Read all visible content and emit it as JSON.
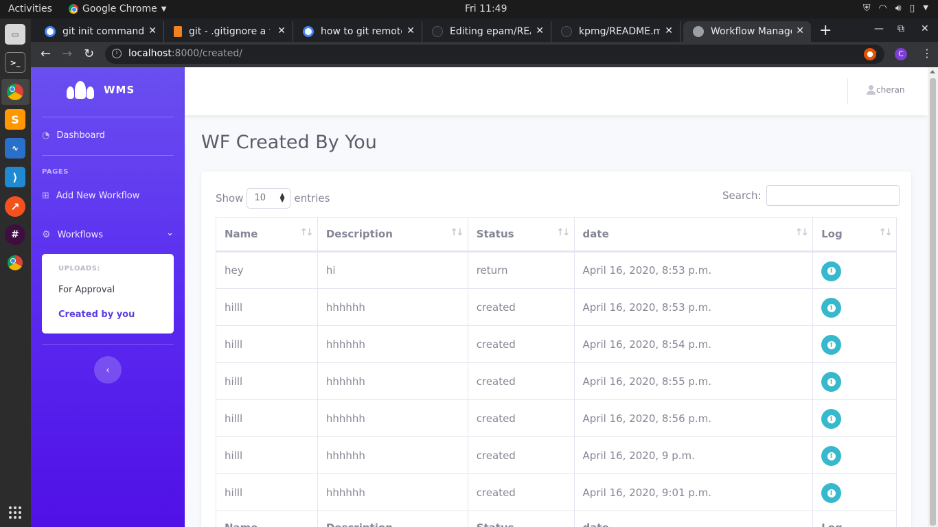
{
  "os": {
    "activities_label": "Activities",
    "app_name": "Google Chrome",
    "clock": "Fri 11:49"
  },
  "browser": {
    "tabs": [
      {
        "title": "git init command -",
        "favicon_color": "#4285f4"
      },
      {
        "title": "git - .gitignore a fo",
        "favicon_color": "#f48024"
      },
      {
        "title": "how to git remote",
        "favicon_color": "#4285f4"
      },
      {
        "title": "Editing epam/REA",
        "favicon_color": "#24292e"
      },
      {
        "title": "kpmg/README.m",
        "favicon_color": "#24292e"
      },
      {
        "title": "Workflow Manage",
        "favicon_color": "#9aa0a6"
      }
    ],
    "url_host": "localhost",
    "url_path": ":8000/created/",
    "profile_initial": "C"
  },
  "sidebar": {
    "brand": "WMS",
    "dashboard_label": "Dashboard",
    "pages_heading": "PAGES",
    "add_workflow_label": "Add New Workflow",
    "workflows_label": "Workflows",
    "uploads_heading": "UPLOADS:",
    "for_approval_label": "For Approval",
    "created_by_you_label": "Created by you"
  },
  "topnav": {
    "username": "cheran"
  },
  "main": {
    "title": "WF Created By You",
    "show_label": "Show",
    "entries_value": "10",
    "entries_label": "entries",
    "search_label": "Search:"
  },
  "table": {
    "columns": [
      "Name",
      "Description",
      "Status",
      "date",
      "Log"
    ],
    "rows": [
      {
        "name": "hey",
        "description": "hi",
        "status": "return",
        "date": "April 16, 2020, 8:53 p.m."
      },
      {
        "name": "hilll",
        "description": "hhhhhh",
        "status": "created",
        "date": "April 16, 2020, 8:53 p.m."
      },
      {
        "name": "hilll",
        "description": "hhhhhh",
        "status": "created",
        "date": "April 16, 2020, 8:54 p.m."
      },
      {
        "name": "hilll",
        "description": "hhhhhh",
        "status": "created",
        "date": "April 16, 2020, 8:55 p.m."
      },
      {
        "name": "hilll",
        "description": "hhhhhh",
        "status": "created",
        "date": "April 16, 2020, 8:56 p.m."
      },
      {
        "name": "hilll",
        "description": "hhhhhh",
        "status": "created",
        "date": "April 16, 2020, 9 p.m."
      },
      {
        "name": "hilll",
        "description": "hhhhhh",
        "status": "created",
        "date": "April 16, 2020, 9:01 p.m."
      }
    ]
  },
  "colors": {
    "sidebar_top": "#6a4ff0",
    "sidebar_bottom": "#5010e6",
    "info_button": "#36b9cc",
    "active_link": "#5a3fe0"
  }
}
